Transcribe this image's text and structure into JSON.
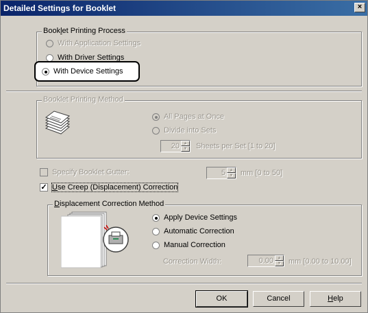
{
  "window": {
    "title": "Detailed Settings for Booklet",
    "close_label": "×"
  },
  "process": {
    "label": "Booklet Printing Process",
    "options": [
      "With Application Settings",
      "With Driver Settings",
      "With Device Settings"
    ],
    "selected": "With Device Settings"
  },
  "method": {
    "label": "Booklet Printing Method",
    "options": [
      "All Pages at Once",
      "Divide into Sets"
    ],
    "selected": "All Pages at Once",
    "sheets_value": "20",
    "sheets_label": "Sheets per Set [1 to 20]"
  },
  "gutter": {
    "label": "Specify Booklet Gutter:",
    "checked": false,
    "value": "5",
    "unit": "mm [0 to 50]"
  },
  "creep": {
    "label": "Use Creep (Displacement) Correction",
    "checked": true,
    "method_label": "Displacement Correction Method",
    "options": [
      "Apply Device Settings",
      "Automatic Correction",
      "Manual Correction"
    ],
    "selected": "Apply Device Settings",
    "width_label": "Correction Width:",
    "width_value": "0.00",
    "width_unit": "mm [0.00 to 10.00]"
  },
  "buttons": {
    "ok": "OK",
    "cancel": "Cancel",
    "help": "Help"
  }
}
